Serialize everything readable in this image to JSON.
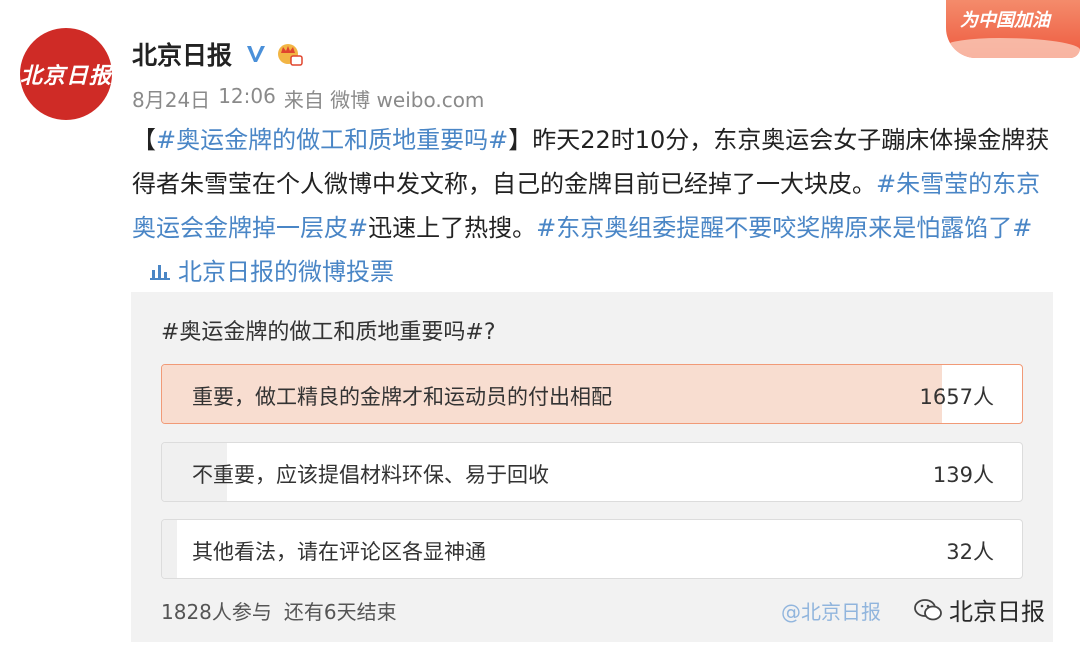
{
  "author": {
    "avatar_text": "北京日报",
    "name": "北京日报",
    "verified_icon": "verified-v-icon",
    "vip_icon": "crown-vip-icon"
  },
  "meta": {
    "date": "8月24日",
    "time": "12:06",
    "source": "来自 微博 weibo.com"
  },
  "cheer_badge": "为中国加油",
  "post": {
    "tag1": "#奥运金牌的做工和质地重要吗#",
    "text1": "昨天22时10分，东京奥运会女子蹦床体操金牌获得者朱雪莹在个人微博中发文称，自己的金牌目前已经掉了一大块皮。",
    "tag2": "#朱雪莹的东京奥运会金牌掉一层皮#",
    "text2": "迅速上了热搜。",
    "tag3": "#东京奥组委提醒不要咬奖牌原来是怕露馅了#",
    "vote_icon": "poll-chart-icon",
    "vote_link": "北京日报的微博投票"
  },
  "poll": {
    "question": "#奥运金牌的做工和质地重要吗#?",
    "options": [
      {
        "label": "重要，做工精良的金牌才和运动员的付出相配",
        "count": "1657人",
        "share": 0.907
      },
      {
        "label": "不重要，应该提倡材料环保、易于回收",
        "count": "139人",
        "share": 0.076
      },
      {
        "label": "其他看法，请在评论区各显神通",
        "count": "32人",
        "share": 0.018
      }
    ],
    "participants": "1828人参与",
    "remaining": "还有6天结束"
  },
  "watermark": {
    "icon": "wechat-icon",
    "text": "北京日报",
    "ghost_text": "@北京日报"
  },
  "colors": {
    "brand_red": "#cf2b26",
    "link_blue": "#4a86c6",
    "selected_fill": "#f8ddd0",
    "selected_border": "#f19a77"
  }
}
